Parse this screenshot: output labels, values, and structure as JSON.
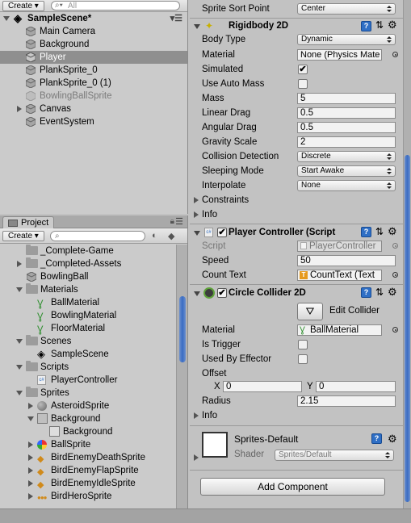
{
  "hierarchy": {
    "create_label": "Create",
    "search_placeholder": "All",
    "scene_name": "SampleScene*",
    "items": [
      {
        "label": "Main Camera"
      },
      {
        "label": "Background"
      },
      {
        "label": "Player"
      },
      {
        "label": "PlankSprite_0"
      },
      {
        "label": "PlankSprite_0 (1)"
      },
      {
        "label": "BowlingBallSprite"
      },
      {
        "label": "Canvas"
      },
      {
        "label": "EventSystem"
      }
    ]
  },
  "project": {
    "tab_label": "Project",
    "create_label": "Create",
    "search_placeholder": "",
    "items": [
      {
        "label": "_Complete-Game"
      },
      {
        "label": "_Completed-Assets"
      },
      {
        "label": "BowlingBall"
      },
      {
        "label": "Materials"
      },
      {
        "label": "BallMaterial"
      },
      {
        "label": "BowlingMaterial"
      },
      {
        "label": "FloorMaterial"
      },
      {
        "label": "Scenes"
      },
      {
        "label": "SampleScene"
      },
      {
        "label": "Scripts"
      },
      {
        "label": "PlayerController"
      },
      {
        "label": "Sprites"
      },
      {
        "label": "AsteroidSprite"
      },
      {
        "label": "Background"
      },
      {
        "label": "Background"
      },
      {
        "label": "BallSprite"
      },
      {
        "label": "BirdEnemyDeathSprite"
      },
      {
        "label": "BirdEnemyFlapSprite"
      },
      {
        "label": "BirdEnemyIdleSprite"
      },
      {
        "label": "BirdHeroSprite"
      }
    ]
  },
  "inspector": {
    "sort_point_label": "Sprite Sort Point",
    "sort_point_value": "Center",
    "rigidbody": {
      "title": "Rigidbody 2D",
      "body_type_label": "Body Type",
      "body_type_value": "Dynamic",
      "material_label": "Material",
      "material_value": "None (Physics Mate",
      "simulated_label": "Simulated",
      "simulated_check": "✔",
      "auto_mass_label": "Use Auto Mass",
      "mass_label": "Mass",
      "mass_value": "5",
      "linear_drag_label": "Linear Drag",
      "linear_drag_value": "0.5",
      "angular_drag_label": "Angular Drag",
      "angular_drag_value": "0.5",
      "gravity_label": "Gravity Scale",
      "gravity_value": "2",
      "collision_label": "Collision Detection",
      "collision_value": "Discrete",
      "sleeping_label": "Sleeping Mode",
      "sleeping_value": "Start Awake",
      "interpolate_label": "Interpolate",
      "interpolate_value": "None",
      "constraints_label": "Constraints",
      "info_label": "Info"
    },
    "player_controller": {
      "title": "Player Controller (Script",
      "script_label": "Script",
      "script_value": "PlayerController",
      "speed_label": "Speed",
      "speed_value": "50",
      "count_text_label": "Count Text",
      "count_text_value": "CountText (Text"
    },
    "circle_collider": {
      "title": "Circle Collider 2D",
      "edit_collider_label": "Edit Collider",
      "material_label": "Material",
      "material_value": "BallMaterial",
      "is_trigger_label": "Is Trigger",
      "effector_label": "Used By Effector",
      "offset_label": "Offset",
      "x_label": "X",
      "x_value": "0",
      "y_label": "Y",
      "y_value": "0",
      "radius_label": "Radius",
      "radius_value": "2.15",
      "info_label": "Info"
    },
    "material_preview": {
      "name": "Sprites-Default",
      "shader_label": "Shader",
      "shader_value": "Sprites/Default"
    },
    "add_component_label": "Add Component"
  },
  "colors": {
    "accent": "#3a6cc2",
    "selection": "#8f8f8f",
    "panel": "#cbcbcb",
    "inspector_bg": "#c2c2c2"
  }
}
